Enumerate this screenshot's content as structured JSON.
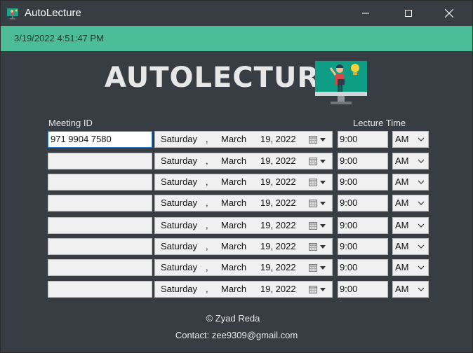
{
  "window": {
    "title": "AutoLecture"
  },
  "status": {
    "datetime": "3/19/2022 4:51:47 PM"
  },
  "logo": {
    "text": "AUTOLECTURE"
  },
  "headers": {
    "meeting_id": "Meeting ID",
    "lecture_time": "Lecture Time"
  },
  "rows": [
    {
      "meeting_id": "971 9904 7580",
      "day": "Saturday",
      "comma": ",",
      "month": "March",
      "date_num": "19, 2022",
      "time": "9:00",
      "ampm": "AM"
    },
    {
      "meeting_id": "",
      "day": "Saturday",
      "comma": ",",
      "month": "March",
      "date_num": "19, 2022",
      "time": "9:00",
      "ampm": "AM"
    },
    {
      "meeting_id": "",
      "day": "Saturday",
      "comma": ",",
      "month": "March",
      "date_num": "19, 2022",
      "time": "9:00",
      "ampm": "AM"
    },
    {
      "meeting_id": "",
      "day": "Saturday",
      "comma": ",",
      "month": "March",
      "date_num": "19, 2022",
      "time": "9:00",
      "ampm": "AM"
    },
    {
      "meeting_id": "",
      "day": "Saturday",
      "comma": ",",
      "month": "March",
      "date_num": "19, 2022",
      "time": "9:00",
      "ampm": "AM"
    },
    {
      "meeting_id": "",
      "day": "Saturday",
      "comma": ",",
      "month": "March",
      "date_num": "19, 2022",
      "time": "9:00",
      "ampm": "AM"
    },
    {
      "meeting_id": "",
      "day": "Saturday",
      "comma": ",",
      "month": "March",
      "date_num": "19, 2022",
      "time": "9:00",
      "ampm": "AM"
    },
    {
      "meeting_id": "",
      "day": "Saturday",
      "comma": ",",
      "month": "March",
      "date_num": "19, 2022",
      "time": "9:00",
      "ampm": "AM"
    }
  ],
  "footer": {
    "credit": "© Zyad Reda",
    "contact": "Contact: zee9309@gmail.com"
  },
  "colors": {
    "background": "#383d44",
    "status_bar": "#4dbd97",
    "field": "#f0f0f0",
    "active_border": "#2d7fd3"
  },
  "icons": {
    "app": "monitor-presenter-icon",
    "calendar": "calendar-icon",
    "dropdown": "chevron-down-icon"
  }
}
